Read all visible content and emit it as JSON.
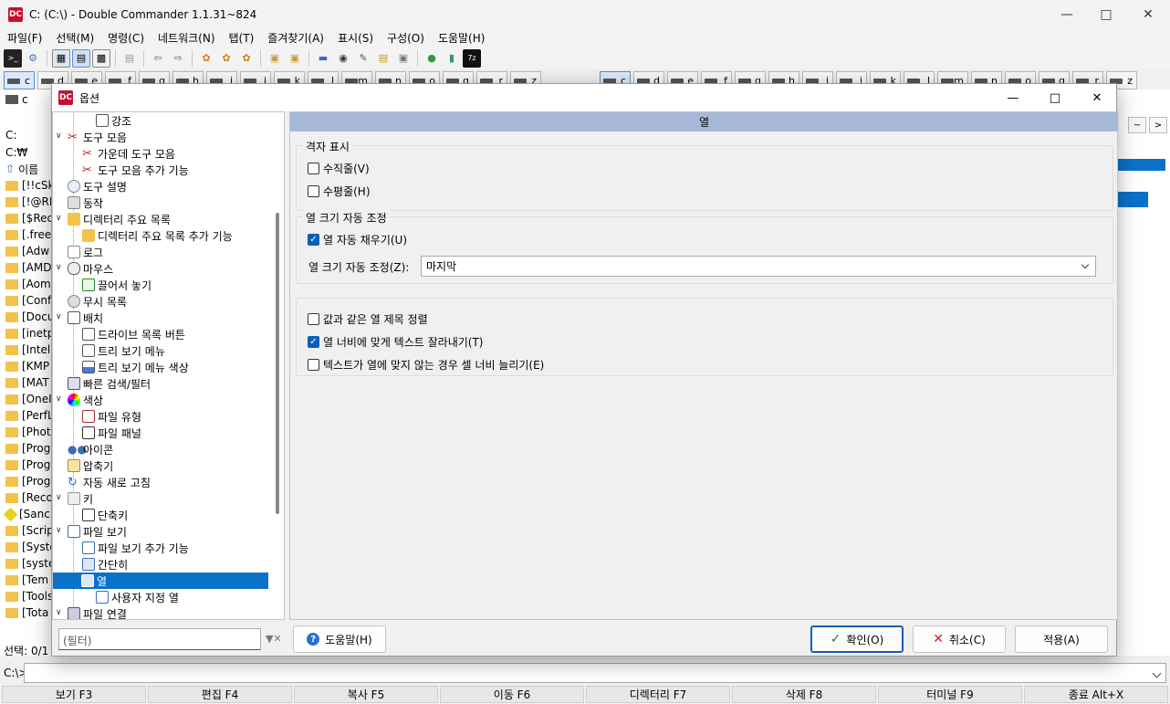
{
  "window": {
    "title": "C: (C:\\) - Double Commander 1.1.31~824",
    "icon_text": "DC"
  },
  "menu": [
    "파일(F)",
    "선택(M)",
    "명령(C)",
    "네트워크(N)",
    "탭(T)",
    "즐겨찾기(A)",
    "표시(S)",
    "구성(O)",
    "도움말(H)"
  ],
  "drives_left": [
    "c",
    "d",
    "e",
    "f",
    "g",
    "h",
    "i",
    "j",
    "k",
    "l",
    "m",
    "n",
    "o",
    "q",
    "r",
    "z"
  ],
  "drives_right": [
    "c",
    "d",
    "e",
    "f",
    "g",
    "h",
    "i",
    "j",
    "k",
    "l",
    "m",
    "n",
    "o",
    "q",
    "r",
    "z"
  ],
  "left_panel": {
    "tab": "c",
    "path_label": "C:",
    "path": "C:₩",
    "column_name": "이름",
    "rows": [
      "[!!cSk",
      "[!@RI",
      "[$Rec",
      "[.free",
      "[Adw",
      "[AMD",
      "[Aom",
      "[Conf",
      "[Docu",
      "[inetp",
      "[Intel]",
      "[KMP",
      "[MAT",
      "[OneI",
      "[PerfL",
      "[Phot",
      "[Prog",
      "[Prog",
      "[Prog",
      "[Reco",
      "[Sanc",
      "[Scrip",
      "[Syste",
      "[syste",
      "[Tem",
      "[Tools",
      "[Tota"
    ],
    "status": "선택: 0/1"
  },
  "command_line": {
    "label": "C:\\>"
  },
  "fkeys": [
    "보기 F3",
    "편집 F4",
    "복사 F5",
    "이동 F6",
    "디렉터리 F7",
    "삭제 F8",
    "터미널 F9",
    "종료 Alt+X"
  ],
  "dialog": {
    "title": "옵션",
    "icon_text": "DC",
    "tree": [
      {
        "label": "강조",
        "level": 2
      },
      {
        "label": "도구 모음",
        "level": 1
      },
      {
        "label": "가운데 도구 모음",
        "level": 2
      },
      {
        "label": "도구 모음 추가 기능",
        "level": 2
      },
      {
        "label": "도구 설명",
        "level": 1
      },
      {
        "label": "동작",
        "level": 1
      },
      {
        "label": "디렉터리 주요 목록",
        "level": 1
      },
      {
        "label": "디렉터리 주요 목록 추가 기능",
        "level": 2
      },
      {
        "label": "로그",
        "level": 1
      },
      {
        "label": "마우스",
        "level": 1
      },
      {
        "label": "끌어서 놓기",
        "level": 2
      },
      {
        "label": "무시 목록",
        "level": 1
      },
      {
        "label": "배치",
        "level": 1
      },
      {
        "label": "드라이브 목록 버튼",
        "level": 2
      },
      {
        "label": "트리 보기 메뉴",
        "level": 2
      },
      {
        "label": "트리 보기 메뉴 색상",
        "level": 2
      },
      {
        "label": "빠른 검색/필터",
        "level": 1
      },
      {
        "label": "색상",
        "level": 1
      },
      {
        "label": "파일 유형",
        "level": 2
      },
      {
        "label": "파일 패널",
        "level": 2
      },
      {
        "label": "아이콘",
        "level": 1
      },
      {
        "label": "압축기",
        "level": 1
      },
      {
        "label": "자동 새로 고침",
        "level": 1
      },
      {
        "label": "키",
        "level": 1
      },
      {
        "label": "단축키",
        "level": 2
      },
      {
        "label": "파일 보기",
        "level": 1
      },
      {
        "label": "파일 보기 추가 기능",
        "level": 2
      },
      {
        "label": "간단히",
        "level": 2
      },
      {
        "label": "열",
        "level": 2
      },
      {
        "label": "사용자 지정 열",
        "level": 3
      },
      {
        "label": "파일 연결",
        "level": 1
      }
    ],
    "selected_tree_item": "열",
    "filter_placeholder": "(필터)",
    "page": {
      "header": "열",
      "grid_group": {
        "title": "격자 표시",
        "vertical": {
          "label": "수직줄(V)",
          "checked": false
        },
        "horizontal": {
          "label": "수평줄(H)",
          "checked": false
        }
      },
      "autosize_group": {
        "title": "열 크기 자동 조정",
        "autofill": {
          "label": "열 자동 채우기(U)",
          "checked": true
        },
        "autosize_label": "열 크기 자동 조정(Z):",
        "autosize_value": "마지막"
      },
      "misc_group": {
        "title_align": {
          "label": "값과 같은 열 제목 정렬",
          "checked": false
        },
        "cut_text": {
          "label": "열 너비에 맞게 텍스트 잘라내기(T)",
          "checked": true
        },
        "extend_cell": {
          "label": "텍스트가 열에 맞지 않는 경우 셀 너비 늘리기(E)",
          "checked": false
        }
      }
    },
    "buttons": {
      "help": "도움말(H)",
      "ok": "확인(O)",
      "cancel": "취소(C)",
      "apply": "적용(A)"
    }
  }
}
